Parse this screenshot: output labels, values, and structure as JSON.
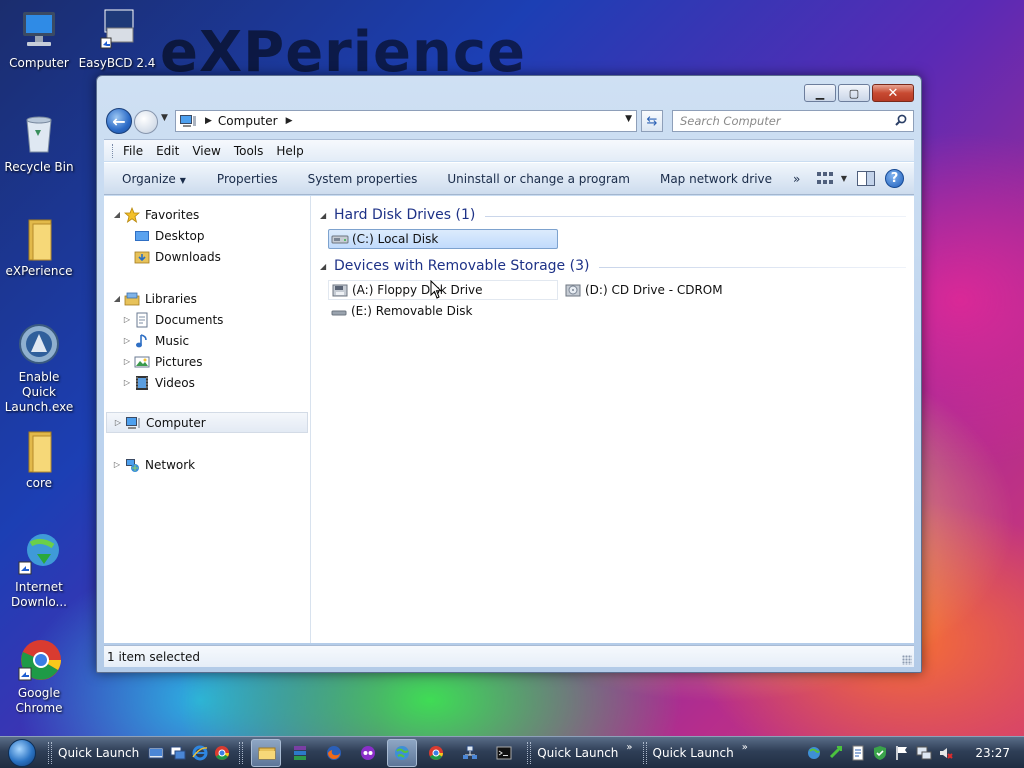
{
  "desktop": {
    "watermark": "eXPerience",
    "icons": [
      {
        "label": "Computer",
        "icon": "computer-icon"
      },
      {
        "label": "EasyBCD 2.4",
        "icon": "easybcd-icon"
      },
      {
        "label": "Recycle Bin",
        "icon": "recycle-bin-icon"
      },
      {
        "label": "eXPerience",
        "icon": "folder-icon"
      },
      {
        "label": "Enable Quick Launch.exe",
        "icon": "quick-launch-exe-icon"
      },
      {
        "label": "core",
        "icon": "folder-icon"
      },
      {
        "label": "Internet Downlo...",
        "icon": "internet-download-manager-icon"
      },
      {
        "label": "Google Chrome",
        "icon": "chrome-icon"
      }
    ]
  },
  "window": {
    "address": {
      "location": "Computer"
    },
    "search": {
      "placeholder": "Search Computer"
    },
    "menu": {
      "file": "File",
      "edit": "Edit",
      "view": "View",
      "tools": "Tools",
      "help": "Help"
    },
    "commands": {
      "organize": "Organize",
      "properties": "Properties",
      "system_properties": "System properties",
      "uninstall": "Uninstall or change a program",
      "map_drive": "Map network drive",
      "more": "»"
    },
    "nav": {
      "favorites": "Favorites",
      "desktop": "Desktop",
      "downloads": "Downloads",
      "libraries": "Libraries",
      "documents": "Documents",
      "music": "Music",
      "pictures": "Pictures",
      "videos": "Videos",
      "computer": "Computer",
      "network": "Network"
    },
    "groups": {
      "hdd": {
        "title": "Hard Disk Drives (1)",
        "drives": [
          {
            "label": "(C:) Local Disk",
            "selected": true
          }
        ]
      },
      "removable": {
        "title": "Devices with Removable Storage (3)",
        "drives": [
          {
            "label": "(A:) Floppy Disk Drive"
          },
          {
            "label": "(D:) CD Drive - CDROM"
          },
          {
            "label": "(E:) Removable Disk"
          }
        ]
      }
    },
    "status": "1 item selected"
  },
  "taskbar": {
    "quick_launch_1": "Quick Launch",
    "quick_launch_2": "Quick Launch",
    "quick_launch_3": "Quick Launch",
    "clock": "23:27"
  },
  "colors": {
    "group_header": "#1e3287",
    "selection": "#c1dbfc"
  }
}
